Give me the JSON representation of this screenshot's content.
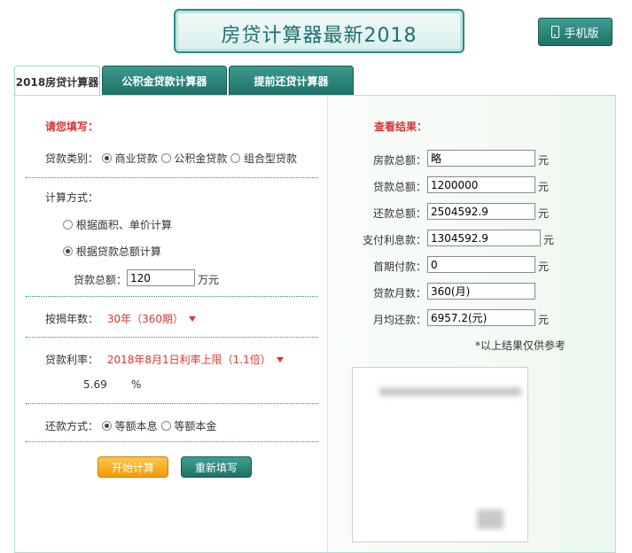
{
  "header": {
    "title": "房贷计算器最新2018",
    "mobile_button": "手机版"
  },
  "tabs": [
    {
      "label": "2018房贷计算器",
      "active": true
    },
    {
      "label": "公积金贷款计算器",
      "active": false
    },
    {
      "label": "提前还贷计算器",
      "active": false
    }
  ],
  "form": {
    "heading": "请您填写：",
    "loan_type": {
      "label": "贷款类别：",
      "options": [
        "商业贷款",
        "公积金贷款",
        "组合型贷款"
      ],
      "selected": "商业贷款"
    },
    "calc_method": {
      "label": "计算方式：",
      "options": [
        "根据面积、单价计算",
        "根据贷款总额计算"
      ],
      "selected": "根据贷款总额计算"
    },
    "loan_total": {
      "label": "贷款总额：",
      "value": "120",
      "unit": "万元"
    },
    "years": {
      "label": "按揭年数：",
      "value": "30年（360期）"
    },
    "rate": {
      "label": "贷款利率：",
      "value": "2018年8月1日利率上限（1.1倍）",
      "number": "5.69",
      "unit": "%"
    },
    "repay_method": {
      "label": "还款方式：",
      "options": [
        "等额本息",
        "等额本金"
      ],
      "selected": "等额本息"
    },
    "buttons": {
      "start": "开始计算",
      "reset": "重新填写"
    }
  },
  "results": {
    "heading": "查看结果：",
    "rows": [
      {
        "label": "房款总额：",
        "value": "略",
        "unit": "元"
      },
      {
        "label": "贷款总额：",
        "value": "1200000",
        "unit": "元"
      },
      {
        "label": "还款总额：",
        "value": "2504592.9",
        "unit": "元"
      },
      {
        "label": "支付利息款：",
        "value": "1304592.9",
        "unit": "元"
      },
      {
        "label": "首期付款：",
        "value": "0",
        "unit": "元"
      },
      {
        "label": "贷款月数：",
        "value": "360(月)",
        "unit": ""
      },
      {
        "label": "月均还款：",
        "value": "6957.2(元)",
        "unit": "元"
      }
    ],
    "note": "*以上结果仅供参考"
  }
}
